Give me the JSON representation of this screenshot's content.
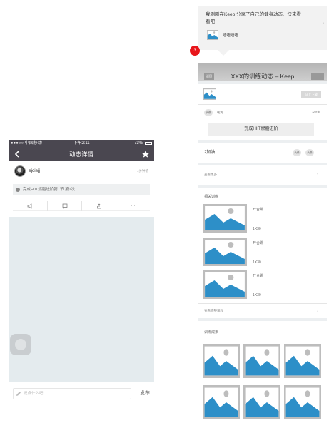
{
  "left_app": {
    "status_bar": {
      "carrier": "●●●○○ 中国移动",
      "time": "下午2:11",
      "battery": "73%"
    },
    "nav": {
      "title": "动态详情"
    },
    "post": {
      "username": "ejcisjj",
      "time_ago": "1分钟前",
      "workout": "完成HIIT燃脂进阶第1节 第1次"
    },
    "actions": [
      "like-icon",
      "comment-icon",
      "share-icon",
      "more-icon"
    ],
    "more_label": "···",
    "comment": {
      "placeholder": "说点什么吧",
      "send_label": "发布"
    }
  },
  "share_card": {
    "message": "我刚刚在Keep 分享了自己的健身动态、快来看看吧",
    "sub": "唔唔唔唔",
    "notification_count": "3"
  },
  "share_page": {
    "header": {
      "title": "XXX的训练动态 – Keep",
      "left_button": "返回",
      "right_button": "..."
    },
    "download_button": "马上下载",
    "user": {
      "avatar_label": "头像",
      "name": "昵称",
      "time": "12分钟"
    },
    "complete_label": "完成HIIT燃脂进阶",
    "likes": {
      "label": "2加油",
      "avatars": [
        "头像",
        "头像"
      ]
    },
    "see_more": "查看更多",
    "related": {
      "title": "相关训练",
      "items": [
        {
          "name": "开合跳",
          "meta": "1X30"
        },
        {
          "name": "开合跳",
          "meta": "1X30"
        },
        {
          "name": "开合跳",
          "meta": "1X30"
        }
      ]
    },
    "see_full_course": "查看完整课程",
    "results_title": "训练成果"
  },
  "colors": {
    "nav_bg": "#4a4750",
    "badge": "#e8161b",
    "placeholder_blue": "#2d8fc8"
  }
}
